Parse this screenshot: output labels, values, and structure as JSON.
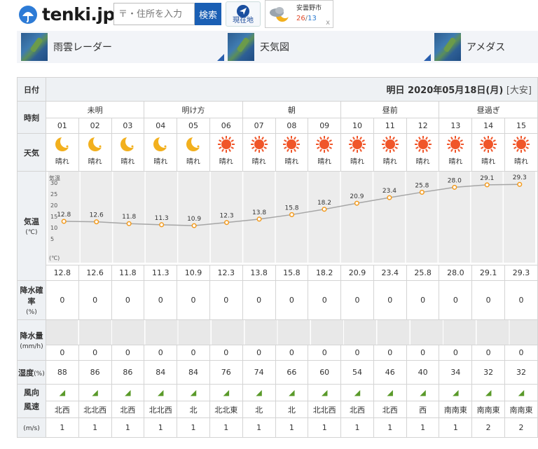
{
  "header": {
    "logo_text": "tenki.jp",
    "search_placeholder": "〒・住所を入力",
    "search_button": "検索",
    "location_button": "現在地",
    "mini_weather": {
      "city": "安曇野市",
      "high": "26",
      "low": "13",
      "close": "x"
    }
  },
  "nav": {
    "items": [
      {
        "label": "雨雲レーダー"
      },
      {
        "label": "天気図"
      },
      {
        "label": "アメダス"
      }
    ]
  },
  "forecast": {
    "labels": {
      "date": "日付",
      "time": "時刻",
      "weather": "天気",
      "temp": "気温",
      "temp_unit": "(℃)",
      "precip_prob": "降水確率",
      "precip_prob_unit": "(%)",
      "precip_amount": "降水量",
      "precip_amount_unit": "(mm/h)",
      "humidity": "湿度",
      "humidity_unit": "(%)",
      "wind_dir": "風向",
      "wind_speed": "風速",
      "wind_speed_unit": "(m/s)"
    },
    "date_text": "明日 2020年05月18日(月)",
    "rokuyo": "[大安]",
    "periods": [
      {
        "label": "未明",
        "span": 3
      },
      {
        "label": "明け方",
        "span": 3
      },
      {
        "label": "朝",
        "span": 3
      },
      {
        "label": "昼前",
        "span": 3
      },
      {
        "label": "昼過ぎ",
        "span": 3
      }
    ],
    "hours": [
      "01",
      "02",
      "03",
      "04",
      "05",
      "06",
      "07",
      "08",
      "09",
      "10",
      "11",
      "12",
      "13",
      "14",
      "15"
    ],
    "weather": [
      {
        "text": "晴れ",
        "icon": "moon-icon"
      },
      {
        "text": "晴れ",
        "icon": "moon-icon"
      },
      {
        "text": "晴れ",
        "icon": "moon-icon"
      },
      {
        "text": "晴れ",
        "icon": "moon-icon"
      },
      {
        "text": "晴れ",
        "icon": "moon-icon"
      },
      {
        "text": "晴れ",
        "icon": "sun-icon"
      },
      {
        "text": "晴れ",
        "icon": "sun-icon"
      },
      {
        "text": "晴れ",
        "icon": "sun-icon"
      },
      {
        "text": "晴れ",
        "icon": "sun-icon"
      },
      {
        "text": "晴れ",
        "icon": "sun-icon"
      },
      {
        "text": "晴れ",
        "icon": "sun-icon"
      },
      {
        "text": "晴れ",
        "icon": "sun-icon"
      },
      {
        "text": "晴れ",
        "icon": "sun-icon"
      },
      {
        "text": "晴れ",
        "icon": "sun-icon"
      },
      {
        "text": "晴れ",
        "icon": "sun-icon"
      }
    ],
    "temps": [
      "12.8",
      "12.6",
      "11.8",
      "11.3",
      "10.9",
      "12.3",
      "13.8",
      "15.8",
      "18.2",
      "20.9",
      "23.4",
      "25.8",
      "28.0",
      "29.1",
      "29.3"
    ],
    "precip_prob": [
      "0",
      "0",
      "0",
      "0",
      "0",
      "0",
      "0",
      "0",
      "0",
      "0",
      "0",
      "0",
      "0",
      "0",
      "0"
    ],
    "precip_amount": [
      "0",
      "0",
      "0",
      "0",
      "0",
      "0",
      "0",
      "0",
      "0",
      "0",
      "0",
      "0",
      "0",
      "0",
      "0"
    ],
    "humidity": [
      "88",
      "86",
      "86",
      "84",
      "84",
      "76",
      "74",
      "66",
      "60",
      "54",
      "46",
      "40",
      "34",
      "32",
      "32"
    ],
    "wind_dir": [
      "北西",
      "北北西",
      "北西",
      "北北西",
      "北",
      "北北東",
      "北",
      "北",
      "北北西",
      "北西",
      "北西",
      "西",
      "南南東",
      "南南東",
      "南南東"
    ],
    "wind_speed": [
      "1",
      "1",
      "1",
      "1",
      "1",
      "1",
      "1",
      "1",
      "1",
      "1",
      "1",
      "1",
      "1",
      "2",
      "2"
    ]
  },
  "chart_data": {
    "type": "line",
    "title": "",
    "xlabel": "",
    "ylabel": "気温",
    "unit_label": "(℃)",
    "ylim": [
      0,
      30
    ],
    "y_ticks": [
      "30",
      "25",
      "20",
      "15",
      "10",
      "5"
    ],
    "x": [
      "01",
      "02",
      "03",
      "04",
      "05",
      "06",
      "07",
      "08",
      "09",
      "10",
      "11",
      "12",
      "13",
      "14",
      "15"
    ],
    "series": [
      {
        "values": [
          12.8,
          12.6,
          11.8,
          11.3,
          10.9,
          12.3,
          13.8,
          15.8,
          18.2,
          20.9,
          23.4,
          25.8,
          28.0,
          29.1,
          29.3
        ]
      }
    ],
    "colors": {
      "line": "#a6a6a6",
      "marker": "#f39a1c"
    }
  },
  "colors": {
    "label_bg": "#eef1f4",
    "search_bg": "#1a5fb4",
    "sun": "#f0562a",
    "moon": "#f2b01e"
  }
}
